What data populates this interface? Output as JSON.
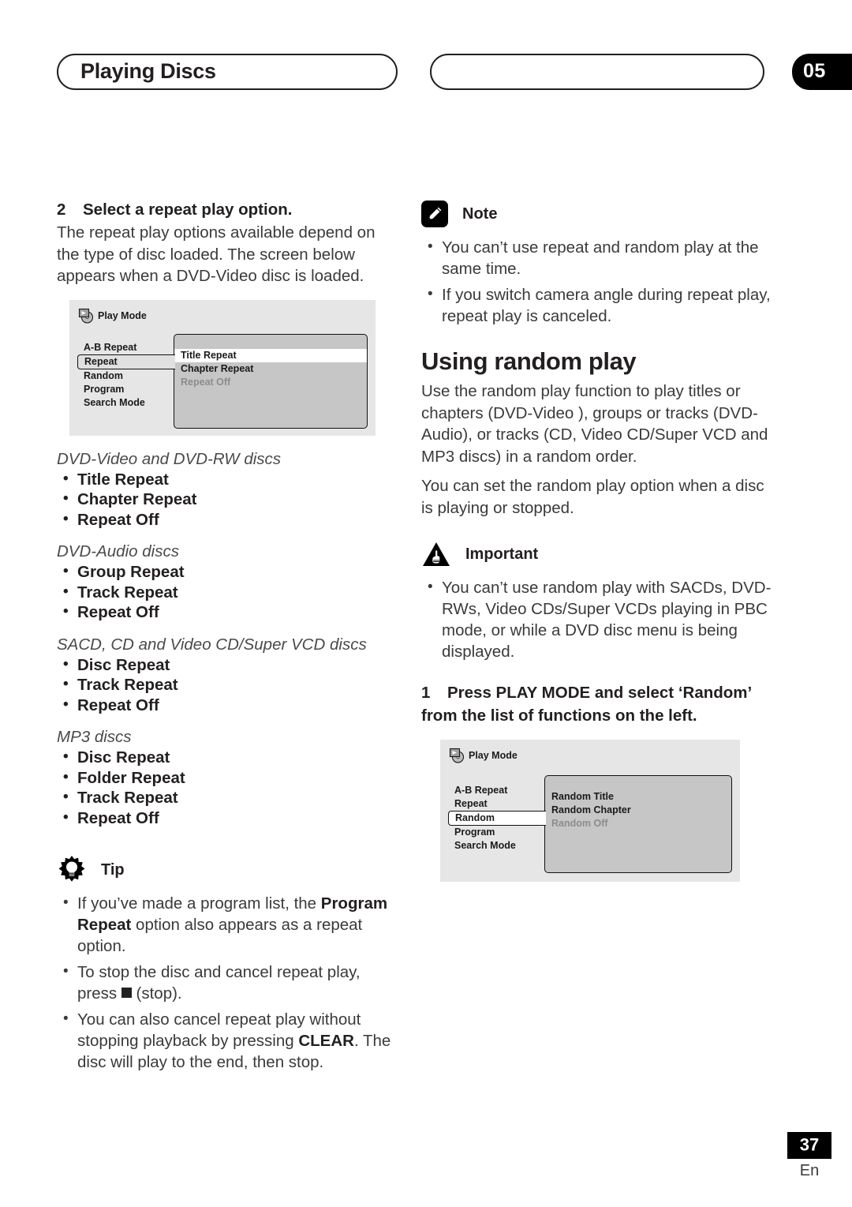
{
  "header": {
    "chapter_title": "Playing Discs",
    "chapter_number": "05"
  },
  "left_column": {
    "step2": {
      "number": "2",
      "title": "Select a repeat play option.",
      "body": "The repeat play options available depend on the type of disc loaded. The screen below appears when a DVD-Video disc is loaded."
    },
    "osd_repeat": {
      "header_label": "Play Mode",
      "header_icon": "play-mode-disc-icon",
      "menu": [
        {
          "label": "A-B Repeat",
          "state": "normal"
        },
        {
          "label": "Repeat",
          "state": "selected"
        },
        {
          "label": "Random",
          "state": "normal"
        },
        {
          "label": "Program",
          "state": "normal"
        },
        {
          "label": "Search Mode",
          "state": "normal"
        }
      ],
      "options": [
        {
          "label": "Title Repeat",
          "state": "highlighted"
        },
        {
          "label": "Chapter Repeat",
          "state": "normal"
        },
        {
          "label": "Repeat Off",
          "state": "dimmed"
        }
      ]
    },
    "disc_categories": [
      {
        "title": "DVD-Video and DVD-RW discs",
        "items": [
          "Title Repeat",
          "Chapter Repeat",
          "Repeat Off"
        ]
      },
      {
        "title": "DVD-Audio discs",
        "items": [
          "Group Repeat",
          "Track Repeat",
          "Repeat Off"
        ]
      },
      {
        "title": "SACD, CD and Video CD/Super VCD discs",
        "items": [
          "Disc Repeat",
          "Track Repeat",
          "Repeat Off"
        ]
      },
      {
        "title": "MP3 discs",
        "items": [
          "Disc Repeat",
          "Folder Repeat",
          "Track Repeat",
          "Repeat Off"
        ]
      }
    ],
    "tip": {
      "title": "Tip",
      "icon": "tip-lightbulb-icon",
      "bullets": [
        {
          "pre": "If you’ve made a program list, the ",
          "bold": "Program Repeat",
          "post": " option also appears as a repeat option."
        },
        {
          "pre": "To stop the disc and cancel repeat play, press ",
          "symbol": "stop-square-icon",
          "post": " (stop)."
        },
        {
          "pre": "You can also cancel repeat play without stopping playback by pressing ",
          "bold": "CLEAR",
          "post": ". The disc will play to the end, then stop."
        }
      ]
    }
  },
  "right_column": {
    "note": {
      "title": "Note",
      "icon": "note-pencil-icon",
      "bullets": [
        "You can’t use repeat and random play at the same time.",
        "If you switch camera angle during repeat play, repeat play is canceled."
      ]
    },
    "random_section": {
      "heading": "Using random play",
      "paragraphs": [
        "Use the random play function to play titles or chapters (DVD-Video ), groups or tracks (DVD-Audio), or tracks (CD, Video CD/Super VCD and MP3 discs) in a random order.",
        "You can set the random play option when a disc is playing or stopped."
      ]
    },
    "important": {
      "title": "Important",
      "icon": "important-hand-icon",
      "bullets": [
        "You can’t use random play with SACDs, DVD-RWs, Video CDs/Super VCDs playing in PBC mode, or while  a DVD disc menu is being displayed."
      ]
    },
    "step1": {
      "number": "1",
      "title": "Press PLAY MODE and select ‘Random’ from the list of functions on the left."
    },
    "osd_random": {
      "header_label": "Play Mode",
      "header_icon": "play-mode-disc-icon",
      "menu": [
        {
          "label": "A-B Repeat",
          "state": "normal"
        },
        {
          "label": "Repeat",
          "state": "normal"
        },
        {
          "label": "Random",
          "state": "selected"
        },
        {
          "label": "Program",
          "state": "normal"
        },
        {
          "label": "Search Mode",
          "state": "normal"
        }
      ],
      "options": [
        {
          "label": "Random Title",
          "state": "normal"
        },
        {
          "label": "Random Chapter",
          "state": "normal"
        },
        {
          "label": "Random Off",
          "state": "dimmed"
        }
      ]
    }
  },
  "footer": {
    "page_number": "37",
    "language": "En"
  }
}
